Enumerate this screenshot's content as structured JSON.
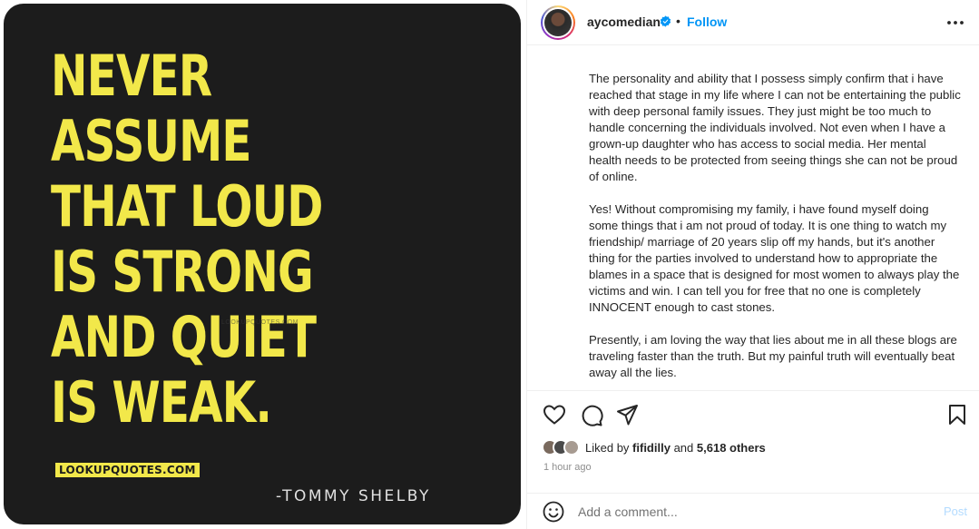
{
  "media": {
    "quote_lines": [
      "NEVER",
      "ASSUME",
      "THAT LOUD",
      "IS STRONG",
      "AND QUIET",
      "IS WEAK."
    ],
    "watermark": "LOOKUPQUOTES.COM",
    "watermark_faint": "LOOKUPQUOTES.COM",
    "author": "-TOMMY SHELBY",
    "colors": {
      "background": "#1c1c1c",
      "quote_text": "#f2e84a"
    }
  },
  "header": {
    "username": "aycomedian",
    "separator": "•",
    "follow_label": "Follow",
    "icons": {
      "verified": "verified-badge-icon",
      "more": "more-options-icon"
    }
  },
  "caption": {
    "paragraphs": [
      "The personality and ability that I possess simply confirm that i have reached that stage in my life where I can not be entertaining the public with deep personal family issues. They just might be too much to handle concerning the individuals involved. Not even when I have a grown-up daughter who has access to social media. Her mental health needs to be protected from seeing things she can not be proud of online.",
      "Yes! Without compromising my family, i have found myself doing some things that i am not proud of today. It is one thing to watch my friendship/ marriage of 20 years slip off my hands, but it's another thing for the parties involved to understand how to appropriate the blames in a space that is designed for most women to always play the victims and win. I can tell you for free that no one is completely INNOCENT enough to cast stones.",
      "Presently, i am loving the way that lies about me in all these blogs are traveling faster than the truth. But my painful truth will eventually beat away all the lies."
    ]
  },
  "actions": {
    "icons": [
      "heart-icon",
      "comment-icon",
      "share-icon",
      "bookmark-icon"
    ],
    "likes_prefix": "Liked by",
    "liked_by_user": "fifidilly",
    "likes_joiner": "and",
    "likes_count": "5,618 others",
    "timestamp": "1 hour ago"
  },
  "comment": {
    "placeholder": "Add a comment...",
    "post_label": "Post",
    "emoji_icon": "emoji-icon"
  },
  "colors": {
    "accent": "#0095f6",
    "post_disabled": "#b3dbff",
    "muted": "#8e8e8e"
  }
}
